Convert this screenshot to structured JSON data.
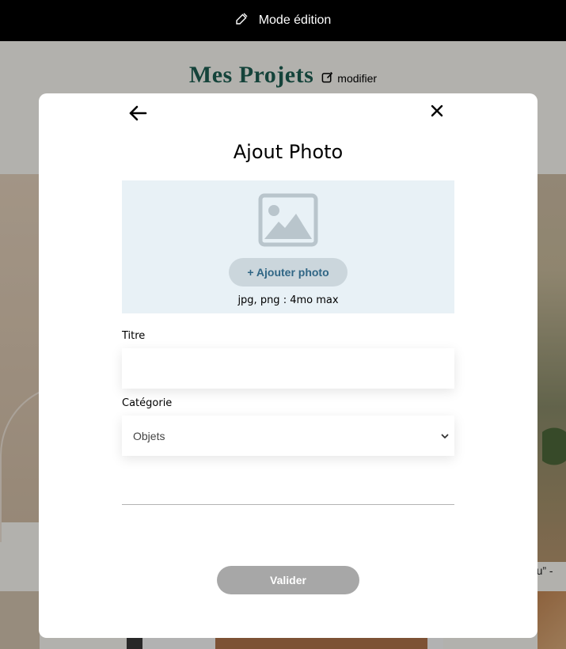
{
  "edit_bar": {
    "label": "Mode édition",
    "icon": "edit-icon"
  },
  "section": {
    "title": "Mes Projets",
    "modify_label": "modifier",
    "modify_icon": "edit-icon"
  },
  "gallery": {
    "visible_caption": "eau” -"
  },
  "modal": {
    "title": "Ajout Photo",
    "back_icon": "arrow-left-icon",
    "close_icon": "close-icon",
    "upload": {
      "icon": "image-icon",
      "button_label": "+ Ajouter photo",
      "hint": "jpg, png : 4mo max"
    },
    "fields": {
      "title_label": "Titre",
      "title_value": "",
      "category_label": "Catégorie",
      "category_value": "Objets"
    },
    "submit_label": "Valider"
  },
  "colors": {
    "brand_green": "#1D6154",
    "upload_bg": "#E8F1F6",
    "upload_button_bg": "#CBD6DC",
    "upload_button_text": "#306685",
    "disabled_button": "#A7A7A7",
    "edit_bar_bg": "#000000"
  }
}
